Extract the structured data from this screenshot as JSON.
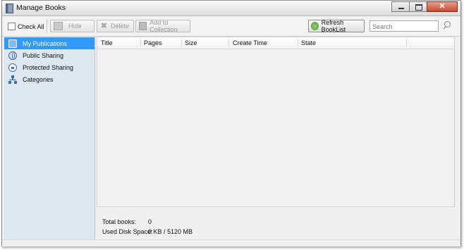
{
  "window": {
    "title": "Manage Books"
  },
  "toolbar": {
    "check_all_label": "Check All",
    "hide_label": "Hide",
    "delete_label": "Delete",
    "add_to_collection_label": "Add to Collection",
    "refresh_label": "Refresh BookList",
    "search_placeholder": "Search"
  },
  "sidebar": {
    "items": [
      {
        "label": "My Publications",
        "icon": "publications-icon",
        "selected": true
      },
      {
        "label": "Public Sharing",
        "icon": "globe-icon",
        "selected": false
      },
      {
        "label": "Protected Sharing",
        "icon": "lock-icon",
        "selected": false
      },
      {
        "label": "Categories",
        "icon": "hierarchy-icon",
        "selected": false
      }
    ]
  },
  "table": {
    "columns": [
      "Title",
      "Pages",
      "Size",
      "Create Time",
      "State"
    ],
    "rows": []
  },
  "footer": {
    "total_books_label": "Total books:",
    "total_books_value": "0",
    "disk_space_label": "Used Disk Space:",
    "disk_space_value": "0 KB / 5120 MB"
  },
  "colors": {
    "selection": "#3399ff",
    "sidebar_bg": "#dde8f1",
    "window_bg": "#f0f0f0",
    "close_button": "#c9492e"
  }
}
